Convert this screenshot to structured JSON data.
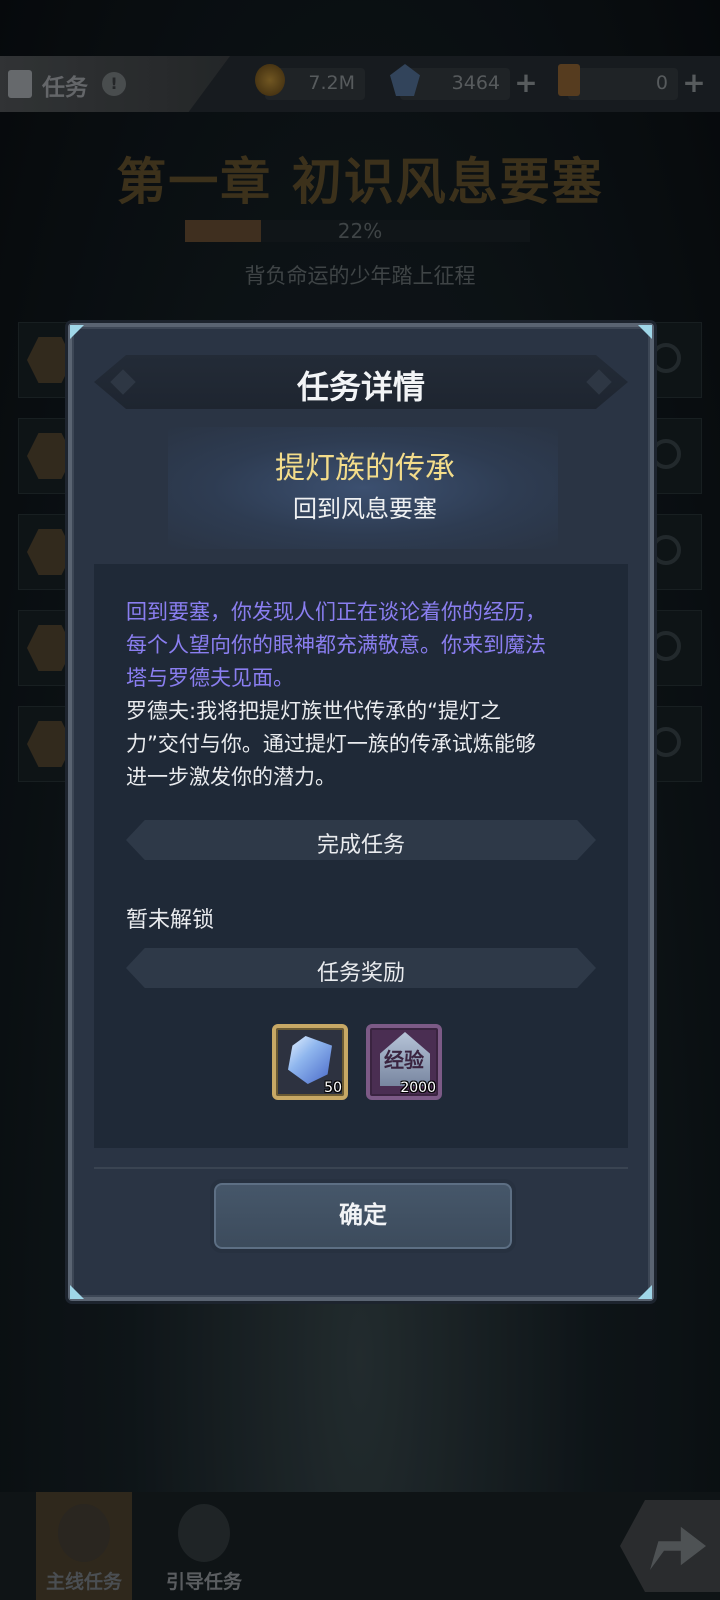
{
  "topbar": {
    "tab_label": "任务",
    "help_symbol": "!",
    "gold": "7.2M",
    "crystals": "3464",
    "tickets": "0",
    "plus_symbol": "+"
  },
  "chapter": {
    "title": "第一章 初识风息要塞",
    "progress_text": "22%",
    "progress": 0.22,
    "subtitle": "背负命运的少年踏上征程"
  },
  "modal": {
    "title": "任务详情",
    "quest_name": "提灯族的传承",
    "quest_sub": "回到风息要塞",
    "desc_purple": [
      "回到要塞，你发现人们正在谈论着你的经历，",
      "每个人望向你的眼神都充满敬意。你来到魔法",
      "塔与罗德夫见面。"
    ],
    "desc_white": [
      "罗德夫:我将把提灯族世代传承的“提灯之",
      "力”交付与你。通过提灯一族的传承试炼能够",
      "进一步激发你的潜力。"
    ],
    "complete_section": "完成任务",
    "locked_text": "暂未解锁",
    "reward_section": "任务奖励",
    "rewards": [
      {
        "icon": "crystal-icon",
        "qty": "50"
      },
      {
        "icon": "exp-icon",
        "label": "经验",
        "qty": "2000"
      }
    ],
    "confirm_label": "确定"
  },
  "bottom_nav": {
    "main_tab": "主线任务",
    "guide_tab": "引导任务"
  },
  "colors": {
    "quest_name": "#f3dc8a",
    "desc_purple": "#8a7ef0",
    "modal_bg": "#2a3444",
    "panel_bg": "#1f2937"
  }
}
